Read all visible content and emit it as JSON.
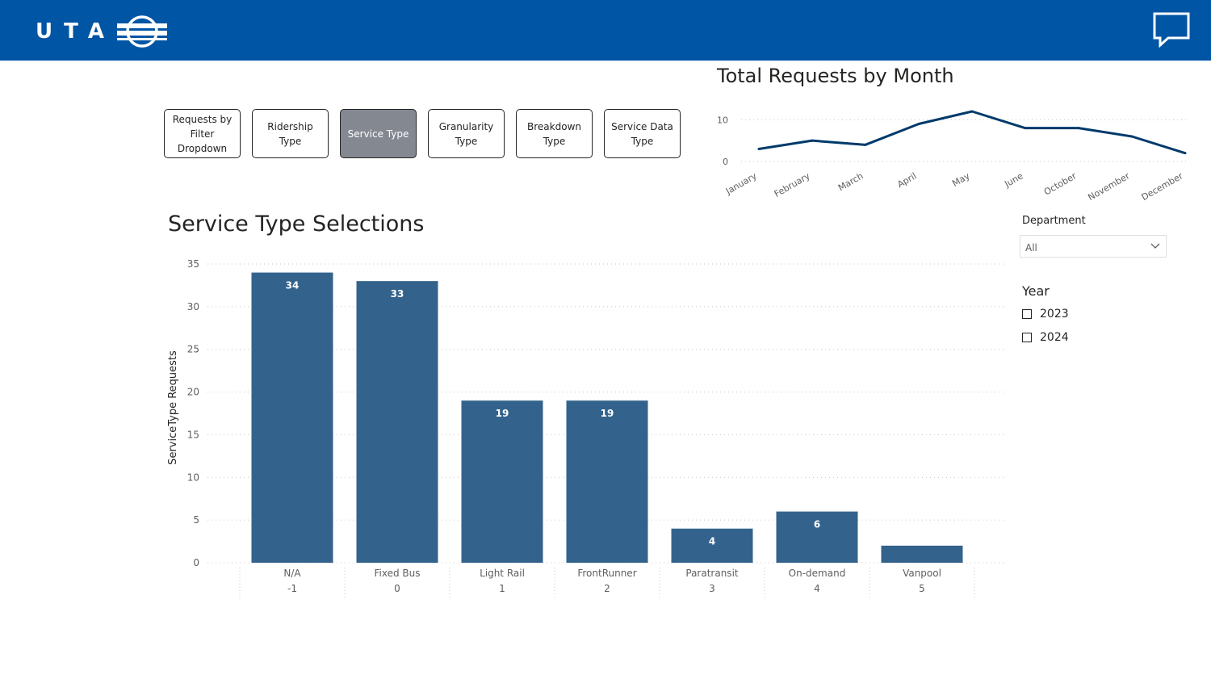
{
  "header": {
    "logo_text": "UTA",
    "chat_icon": "chat-bubble-icon",
    "brand_color": "#0055a5"
  },
  "nav_buttons": [
    {
      "label": "Requests by Filter Dropdown",
      "active": false
    },
    {
      "label": "Ridership Type",
      "active": false
    },
    {
      "label": "Service Type",
      "active": true
    },
    {
      "label": "Granularity Type",
      "active": false
    },
    {
      "label": "Breakdown Type",
      "active": false
    },
    {
      "label": "Service Data Type",
      "active": false
    }
  ],
  "filters": {
    "department_label": "Department",
    "department_value": "All",
    "year_label": "Year",
    "years": [
      "2023",
      "2024"
    ]
  },
  "chart_data": [
    {
      "type": "line",
      "title": "Total Requests by Month",
      "categories": [
        "January",
        "February",
        "March",
        "April",
        "May",
        "June",
        "October",
        "November",
        "December"
      ],
      "values": [
        3,
        5,
        4,
        9,
        12,
        8,
        8,
        6,
        2
      ],
      "y_ticks": [
        0,
        10
      ],
      "ylim": [
        0,
        12
      ],
      "grid": true,
      "color": "#003a6b"
    },
    {
      "type": "bar",
      "title": "Service Type Selections",
      "ylabel": "ServiceType Requests",
      "categories": [
        "N/A",
        "Fixed Bus",
        "Light Rail",
        "FrontRunner",
        "Paratransit",
        "On-demand",
        "Vanpool"
      ],
      "codes": [
        "-1",
        "0",
        "1",
        "2",
        "3",
        "4",
        "5"
      ],
      "values": [
        34,
        33,
        19,
        19,
        4,
        6,
        2
      ],
      "data_labels": [
        "34",
        "33",
        "19",
        "19",
        "4",
        "6",
        ""
      ],
      "y_ticks": [
        0,
        5,
        10,
        15,
        20,
        25,
        30,
        35
      ],
      "ylim": [
        0,
        35
      ],
      "grid": true,
      "color": "#33638c"
    }
  ]
}
